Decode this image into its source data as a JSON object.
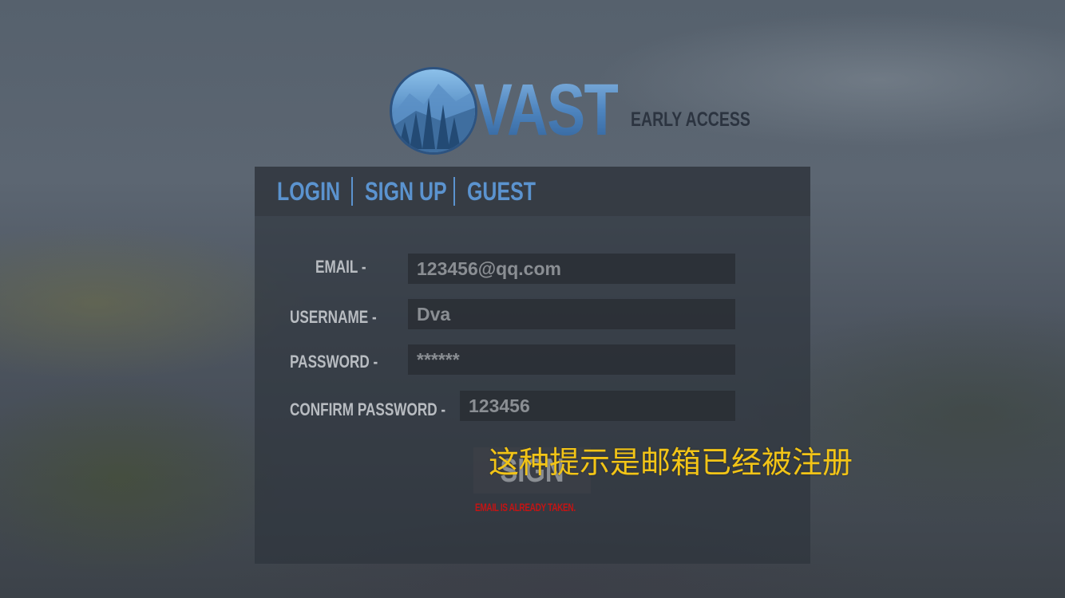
{
  "logo": {
    "wordmark": "VAST",
    "subtitle": "EARLY ACCESS"
  },
  "tabs": [
    {
      "label": "LOGIN"
    },
    {
      "label": "SIGN UP"
    },
    {
      "label": "GUEST"
    }
  ],
  "form": {
    "email": {
      "label": "EMAIL  -",
      "value": "123456@qq.com"
    },
    "username": {
      "label": "USERNAME -",
      "value": "Dva"
    },
    "password": {
      "label": "PASSWORD -",
      "value": "******"
    },
    "confirm_password": {
      "label": "CONFIRM PASSWORD -",
      "value": "123456"
    },
    "submit_label": "SIGN UP",
    "error_message": "EMAIL IS ALREADY TAKEN."
  },
  "overlay_caption": "这种提示是邮箱已经被注册",
  "colors": {
    "accent": "#5b93cf",
    "error": "#c41414",
    "caption": "#f2c417"
  }
}
